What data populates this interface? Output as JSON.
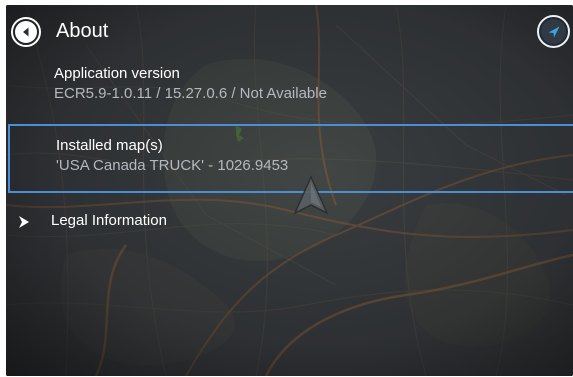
{
  "header": {
    "title": "About",
    "back_icon": "back-arrow-icon",
    "nav_icon": "navigation-arrow-icon"
  },
  "items": [
    {
      "label": "Application version",
      "value": "ECR5.9-1.0.11 / 15.27.0.6 / Not Available"
    },
    {
      "label": "Installed map(s)",
      "value": "'USA Canada TRUCK' - 1026.9453",
      "selected": true
    }
  ],
  "legal": {
    "label": "Legal Information",
    "icon": "chevron-right-icon"
  },
  "map": {
    "marker_icon": "current-position-arrow-icon"
  },
  "colors": {
    "selection_border": "#4a8fd6",
    "nav_accent": "#3ba3e0",
    "secondary_text": "#b4b9bf"
  }
}
